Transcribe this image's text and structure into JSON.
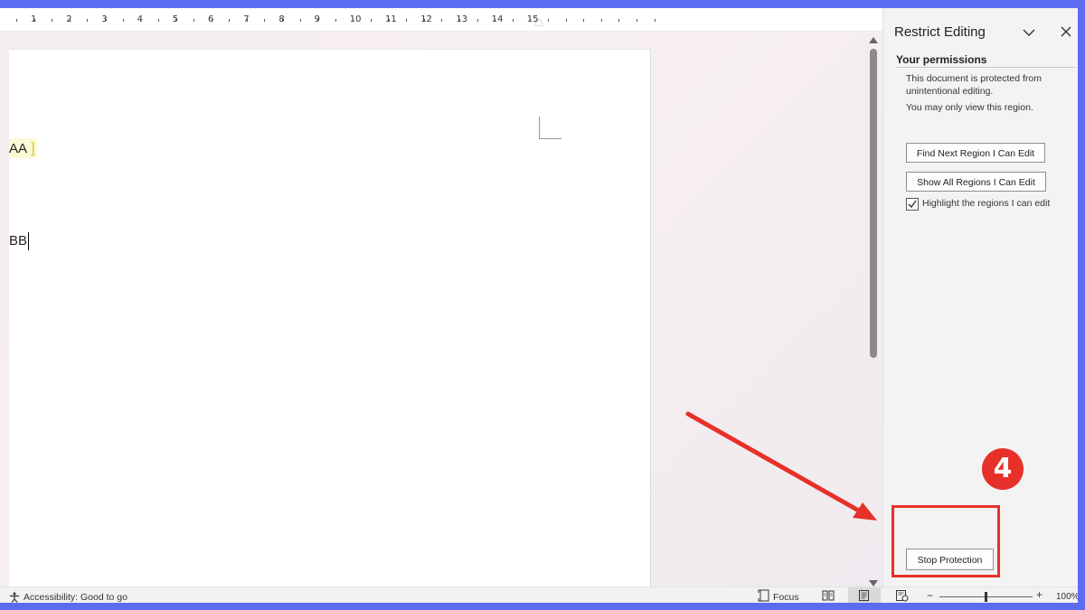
{
  "ruler": {
    "numbers": [
      "1",
      "2",
      "3",
      "4",
      "5",
      "6",
      "7",
      "8",
      "9",
      "10",
      "11",
      "12",
      "13",
      "14",
      "15"
    ]
  },
  "document": {
    "line1": "AA",
    "line2": "BB"
  },
  "pane": {
    "title": "Restrict Editing",
    "section": "Your permissions",
    "message1": "This document is protected from unintentional editing.",
    "message2": "You may only view this region.",
    "find_next_button": "Find Next Region I Can Edit",
    "show_all_button": "Show All Regions I Can Edit",
    "highlight_label": "Highlight the regions I can edit",
    "highlight_checked": true,
    "stop_protection_button": "Stop Protection"
  },
  "annotation": {
    "step_number": "4",
    "color": "#e8302a"
  },
  "status": {
    "accessibility": "Accessibility: Good to go",
    "focus": "Focus",
    "zoom_level": "100%"
  },
  "icons": {
    "pane_collapse": "chevron-down-icon",
    "pane_close": "close-icon",
    "accessibility": "accessibility-icon",
    "focus": "focus-icon",
    "read_mode": "read-mode-icon",
    "print_layout": "print-layout-icon",
    "web_layout": "web-layout-icon"
  }
}
